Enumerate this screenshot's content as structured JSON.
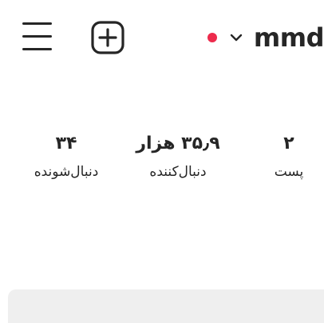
{
  "header": {
    "username": "mmd",
    "menu_icon": "hamburger-menu-icon",
    "create_icon": "plus-square-icon",
    "chevron_icon": "chevron-down-icon",
    "notification_dot_color": "#ed2b4c"
  },
  "stats": {
    "posts": {
      "value": "۲",
      "label": "پست"
    },
    "followers": {
      "value": "۳۵٫۹ هزار",
      "label": "دنبال‌کننده"
    },
    "following": {
      "value": "۳۴",
      "label": "دنبال‌شونده"
    }
  }
}
